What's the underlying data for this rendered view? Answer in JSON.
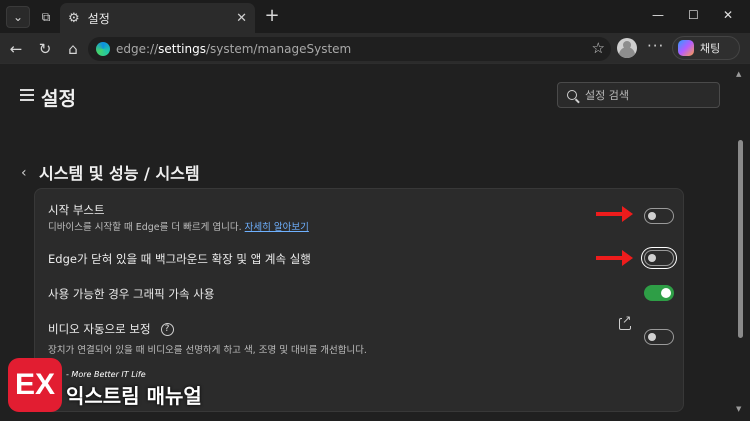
{
  "tab": {
    "title": "설정"
  },
  "address": {
    "scheme": "edge://",
    "host": "settings",
    "path": "/system/manageSystem"
  },
  "toolbar": {
    "chat_label": "채팅"
  },
  "header": {
    "title": "설정",
    "search_placeholder": "설정 검색"
  },
  "breadcrumb": {
    "text": "시스템 및 성능 / 시스템"
  },
  "settings": [
    {
      "title": "시작 부스트",
      "desc": "디바이스를 시작할 때 Edge를 더 빠르게 엽니다.",
      "link": "자세히 알아보기",
      "enabled": false
    },
    {
      "title": "Edge가 닫혀 있을 때 백그라운드 확장 및 앱 계속 실행",
      "enabled": false,
      "focused": true
    },
    {
      "title": "사용 가능한 경우 그래픽 가속 사용",
      "enabled": true
    },
    {
      "title": "비디오 자동으로 보정",
      "help": "?",
      "desc": "장치가 연결되어 있을 때 비디오를 선명하게 하고 색, 조명 및 대비를 개선합니다.",
      "enabled": false
    }
  ],
  "watermark": {
    "logo": "EX",
    "tagline": "- More Better IT Life",
    "name": "익스트림 매뉴얼"
  },
  "colors": {
    "accent_on": "#2e9e46",
    "arrow": "#ee1c1c",
    "link": "#6fb1ff",
    "watermark": "#e21d31"
  }
}
